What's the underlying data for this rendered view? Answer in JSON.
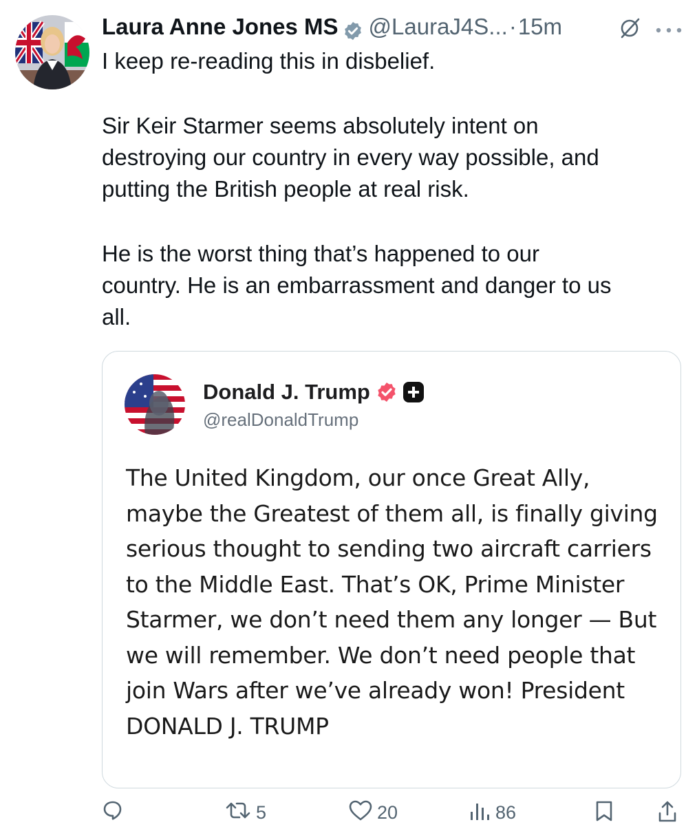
{
  "tweet": {
    "author_name": "Laura Anne Jones MS",
    "handle": "@LauraJ4S...",
    "separator": "·",
    "time": "15m",
    "paragraphs": [
      "I keep re-reading this in disbelief.",
      "Sir Keir Starmer seems absolutely intent on\ndestroying our country in every way possible, and\nputting the British people at real risk.",
      "He is the worst thing that’s happened to our\ncountry. He is an embarrassment and danger to us\nall."
    ],
    "icons": {
      "verified": "verified-badge-icon",
      "grok": "grok-icon",
      "more": "more-options-icon"
    }
  },
  "quote": {
    "author_name": "Donald J. Trump",
    "handle": "@realDonaldTrump",
    "text": "The United Kingdom, our once Great Ally, maybe the Greatest of them all, is finally giving serious thought to sending two aircraft carriers to the Middle East. That’s OK, Prime Minister Starmer, we don’t need them any longer — But we will remember. We don’t need people that join Wars after we’ve already won! President DONALD J. TRUMP",
    "icons": {
      "verified": "verified-badge-icon",
      "plus": "plus-badge-icon"
    }
  },
  "actions": {
    "reply_count": "",
    "retweet_count": "5",
    "like_count": "20",
    "views_count": "86"
  },
  "colors": {
    "verified_blue": "#829aab",
    "quote_verified_pink": "#f4536b",
    "text_primary": "#0f1419",
    "text_secondary": "#536471",
    "border": "#cfd9de"
  }
}
